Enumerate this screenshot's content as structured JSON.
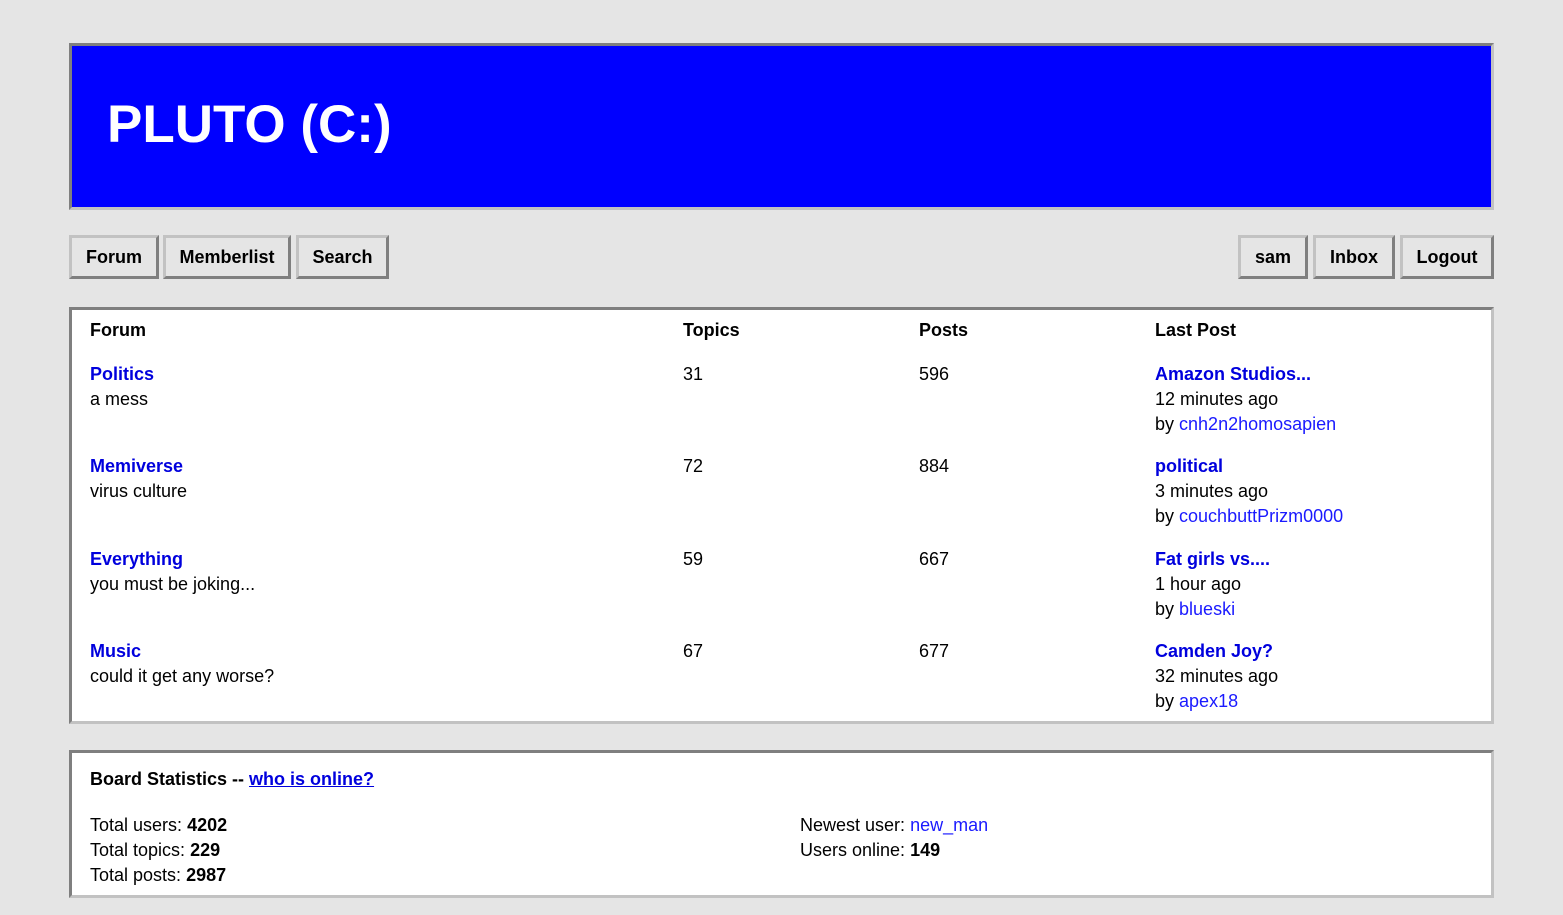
{
  "site": {
    "title": "PLUTO (C:)"
  },
  "nav": {
    "forum": "Forum",
    "memberlist": "Memberlist",
    "search": "Search",
    "user": "sam",
    "inbox": "Inbox",
    "logout": "Logout"
  },
  "table": {
    "headers": {
      "forum": "Forum",
      "topics": "Topics",
      "posts": "Posts",
      "last_post": "Last Post"
    },
    "rows": [
      {
        "name": "Politics",
        "description": "a mess",
        "topics": "31",
        "posts": "596",
        "last_title": "Amazon Studios...",
        "last_time": "12 minutes ago",
        "by_label": "by",
        "last_user": "cnh2n2homosapien"
      },
      {
        "name": "Memiverse",
        "description": "virus culture",
        "topics": "72",
        "posts": "884",
        "last_title": "political",
        "last_time": "3 minutes ago",
        "by_label": "by",
        "last_user": "couchbuttPrizm0000"
      },
      {
        "name": "Everything",
        "description": "you must be joking...",
        "topics": "59",
        "posts": "667",
        "last_title": "Fat girls vs....",
        "last_time": "1 hour ago",
        "by_label": "by",
        "last_user": "blueski"
      },
      {
        "name": "Music",
        "description": "could it get any worse?",
        "topics": "67",
        "posts": "677",
        "last_title": "Camden Joy?",
        "last_time": "32 minutes ago",
        "by_label": "by",
        "last_user": "apex18"
      }
    ]
  },
  "stats": {
    "title": "Board Statistics --",
    "online_link": "who is online?",
    "total_users_label": "Total users:",
    "total_users": "4202",
    "total_topics_label": "Total topics:",
    "total_topics": "229",
    "total_posts_label": "Total posts:",
    "total_posts": "2987",
    "newest_user_label": "Newest user:",
    "newest_user": "new_man",
    "users_online_label": "Users online:",
    "users_online": "149"
  },
  "colors": {
    "header_bg": "#0000ff",
    "page_bg": "#e5e5e5",
    "link": "#0000dd"
  }
}
